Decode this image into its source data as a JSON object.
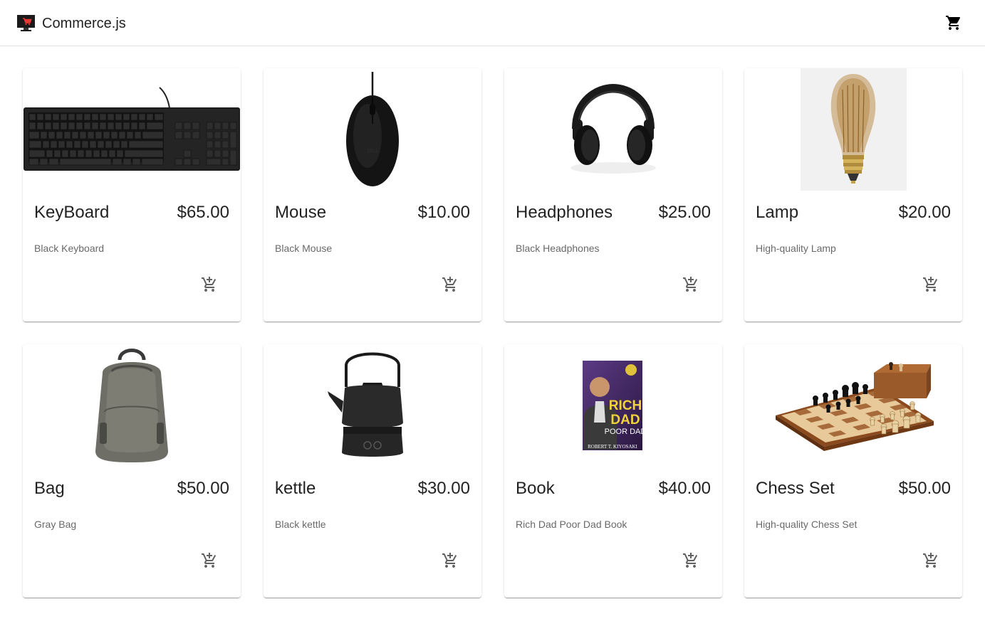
{
  "app": {
    "title": "Commerce.js",
    "logo_icon": "shopping-cart-monitor-logo-icon",
    "cart_icon": "shopping-cart-icon"
  },
  "products": [
    {
      "name": "KeyBoard",
      "price": "$65.00",
      "description": "Black Keyboard",
      "image": "keyboard"
    },
    {
      "name": "Mouse",
      "price": "$10.00",
      "description": "Black Mouse",
      "image": "mouse"
    },
    {
      "name": "Headphones",
      "price": "$25.00",
      "description": "Black Headphones",
      "image": "headphones"
    },
    {
      "name": "Lamp",
      "price": "$20.00",
      "description": "High-quality Lamp",
      "image": "lamp"
    },
    {
      "name": "Bag",
      "price": "$50.00",
      "description": "Gray Bag",
      "image": "bag"
    },
    {
      "name": "kettle",
      "price": "$30.00",
      "description": "Black kettle",
      "image": "kettle"
    },
    {
      "name": "Book",
      "price": "$40.00",
      "description": "Rich Dad Poor Dad Book",
      "image": "book"
    },
    {
      "name": "Chess Set",
      "price": "$50.00",
      "description": "High-quality Chess Set",
      "image": "chess-set"
    }
  ],
  "book_cover": {
    "line1": "RICH",
    "line2": "DAD",
    "line3": "POOR DAD",
    "author": "ROBERT T. KIYOSAKI"
  },
  "colors": {
    "text_primary": "#212121",
    "text_secondary": "#666666",
    "icon": "#616161",
    "divider": "#e0e0e0"
  }
}
